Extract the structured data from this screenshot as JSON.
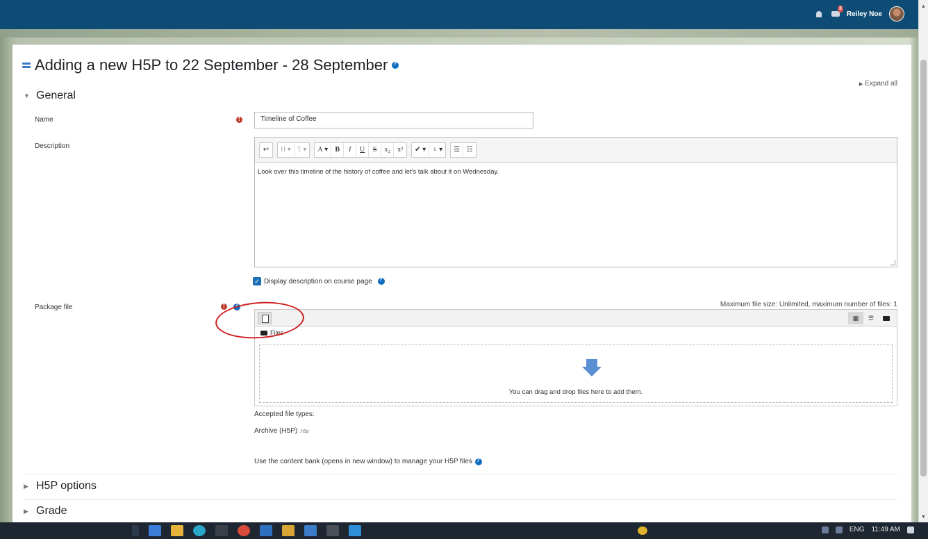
{
  "navbar": {
    "username": "Reiley Noe",
    "message_badge": "3"
  },
  "page": {
    "title": "Adding a new H5P to 22 September - 28 September",
    "expand_all": "Expand all"
  },
  "sections": {
    "general": "General",
    "h5p_options": "H5P options",
    "grade": "Grade"
  },
  "form": {
    "name_label": "Name",
    "name_value": "Timeline of Coffee",
    "description_label": "Description",
    "description_text": "Look over this timeline of the history of coffee and let's talk about it on Wednesday.",
    "display_description_label": "Display description on course page",
    "package_file_label": "Package file",
    "max_file_size": "Maximum file size: Unlimited, maximum number of files: 1",
    "files_folder": "Files",
    "drop_text": "You can drag and drop files here to add them.",
    "accepted_types_label": "Accepted file types:",
    "archive_type": "Archive (H5P)",
    "archive_ext": ".h5p",
    "content_bank_text": "Use the content bank (opens in new window) to manage your H5P files"
  },
  "editor_toolbar": {
    "undo": "↩",
    "heading": "H",
    "font": "T",
    "font_color": "A",
    "bold": "B",
    "italic": "I",
    "underline": "U",
    "strike": "S",
    "subscript": "x₂",
    "superscript": "x²",
    "brush": "✔",
    "lightbulb": "♀",
    "bullet_list": "☰",
    "number_list": "☷"
  },
  "taskbar": {
    "lang": "ENG",
    "time": "11:49 AM"
  },
  "colors": {
    "navbar": "#0f4c75",
    "required": "#c0392b",
    "link": "#0f6cbf",
    "annotation": "#cc1f1f"
  }
}
